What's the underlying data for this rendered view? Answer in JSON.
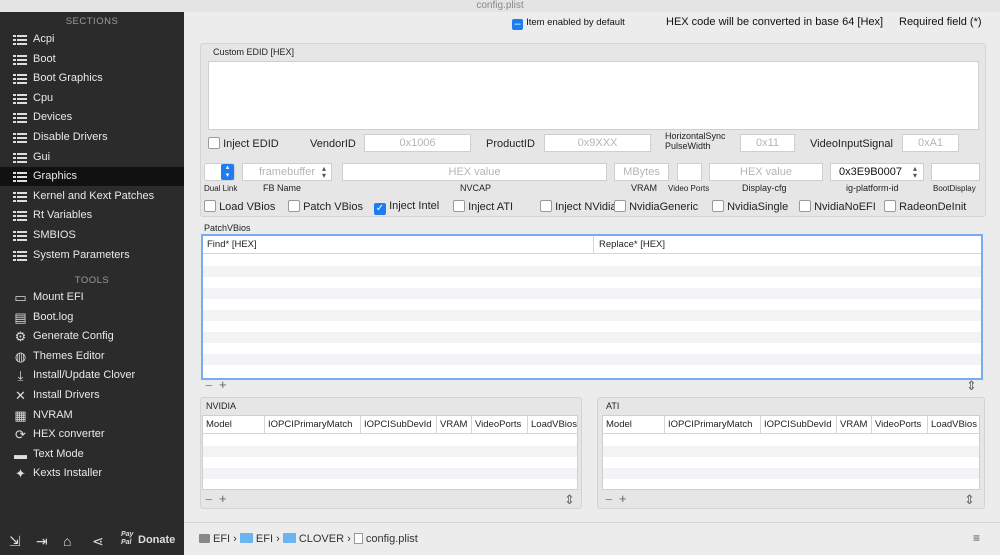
{
  "window": {
    "title": "config.plist"
  },
  "sidebar": {
    "sections_label": "SECTIONS",
    "tools_label": "TOOLS",
    "sections": [
      {
        "label": "Acpi"
      },
      {
        "label": "Boot"
      },
      {
        "label": "Boot Graphics"
      },
      {
        "label": "Cpu"
      },
      {
        "label": "Devices"
      },
      {
        "label": "Disable Drivers"
      },
      {
        "label": "Gui"
      },
      {
        "label": "Graphics"
      },
      {
        "label": "Kernel and Kext Patches"
      },
      {
        "label": "Rt Variables"
      },
      {
        "label": "SMBIOS"
      },
      {
        "label": "System Parameters"
      }
    ],
    "active": "Graphics",
    "tools": [
      {
        "label": "Mount EFI",
        "icon": "drive-icon"
      },
      {
        "label": "Boot.log",
        "icon": "log-icon"
      },
      {
        "label": "Generate Config",
        "icon": "gear-icon"
      },
      {
        "label": "Themes Editor",
        "icon": "palette-icon"
      },
      {
        "label": "Install/Update Clover",
        "icon": "download-icon"
      },
      {
        "label": "Install Drivers",
        "icon": "wrench-icon"
      },
      {
        "label": "NVRAM",
        "icon": "chip-icon"
      },
      {
        "label": "HEX converter",
        "icon": "refresh-icon"
      },
      {
        "label": "Text Mode",
        "icon": "text-icon"
      },
      {
        "label": "Kexts Installer",
        "icon": "puzzle-icon"
      }
    ],
    "bottom": {
      "donate_label": "Donate",
      "paypal_label": "Pay Pal"
    }
  },
  "header": {
    "item_enabled": "Item enabled by default",
    "hex_note": "HEX code will be converted in base 64 [Hex]",
    "required": "Required field (*)"
  },
  "graphics": {
    "custom_edid_label": "Custom EDID [HEX]",
    "inject_edid": "Inject EDID",
    "vendor_label": "VendorID",
    "vendor_placeholder": "0x1006",
    "product_label": "ProductID",
    "product_placeholder": "0x9XXX",
    "hsync_label": "HorizontalSync PulseWidth",
    "hsync_placeholder": "0x11",
    "vsig_label": "VideoInputSignal",
    "vsig_placeholder": "0xA1",
    "fb_placeholder": "framebuffer",
    "nvcap_placeholder": "HEX value",
    "vram_placeholder": "MBytes",
    "display_placeholder": "HEX value",
    "platform_id_value": "0x3E9B0007",
    "row_labels": {
      "dual_link": "Dual Link",
      "fb_name": "FB Name",
      "nvcap": "NVCAP",
      "vram": "VRAM",
      "video_ports": "Video Ports",
      "display_cfg": "Display-cfg",
      "platform_id": "ig-platform-id",
      "boot_display": "BootDisplay"
    },
    "checks": [
      {
        "label": "Load VBios",
        "checked": false
      },
      {
        "label": "Patch VBios",
        "checked": false
      },
      {
        "label": "Inject Intel",
        "checked": true
      },
      {
        "label": "Inject ATI",
        "checked": false
      },
      {
        "label": "Inject NVidia",
        "checked": false
      },
      {
        "label": "NvidiaGeneric",
        "checked": false
      },
      {
        "label": "NvidiaSingle",
        "checked": false
      },
      {
        "label": "NvidiaNoEFI",
        "checked": false
      },
      {
        "label": "RadeonDeInit",
        "checked": false
      }
    ],
    "patchvbios_label": "PatchVBios",
    "patch_columns": [
      "Find* [HEX]",
      "Replace* [HEX]"
    ],
    "nvidia_label": "NVIDIA",
    "ati_label": "ATI",
    "gpu_columns": [
      "Model",
      "IOPCIPrimaryMatch",
      "IOPCISubDevId",
      "VRAM",
      "VideoPorts",
      "LoadVBios"
    ]
  },
  "breadcrumb": [
    "EFI",
    "EFI",
    "CLOVER",
    "config.plist"
  ],
  "colors": {
    "sidebar": "#2b2b2c",
    "accent": "#1e7cf2",
    "folder": "#6cb4f0"
  }
}
